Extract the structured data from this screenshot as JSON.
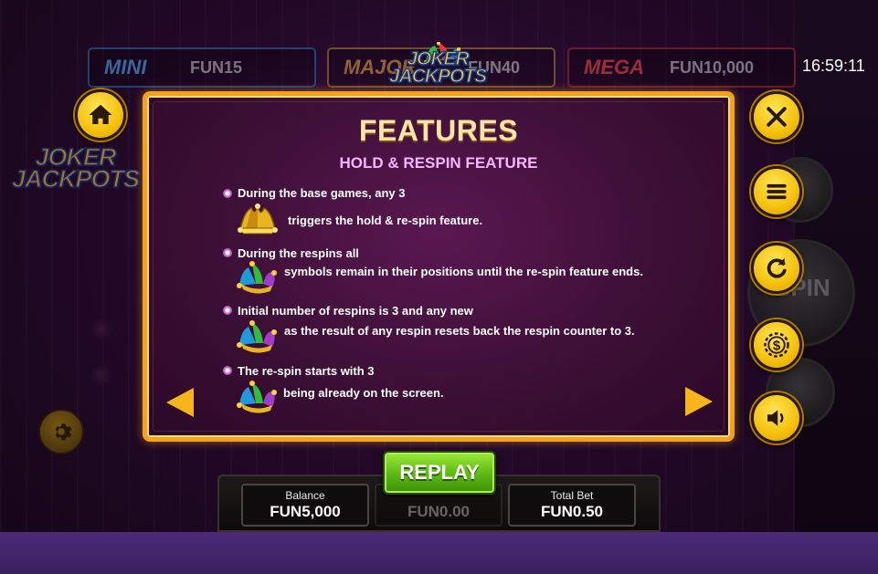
{
  "clock": "16:59:11",
  "jackpots": [
    {
      "name": "MINI",
      "value": "FUN15"
    },
    {
      "name": "MAJOR",
      "value": "FUN40"
    },
    {
      "name": "MEGA",
      "value": "FUN10,000"
    }
  ],
  "logo": {
    "line1": "JOKER",
    "line2": "JACKPOTS"
  },
  "panel": {
    "title": "FEATURES",
    "subtitle": "HOLD & RESPIN FEATURE",
    "features": [
      {
        "line1": "During the base games, any 3",
        "line2": "triggers the hold & re-spin feature.",
        "symbol": "golden-jester-hat"
      },
      {
        "line1": "During the respins all",
        "line2": "symbols remain in their positions until the re-spin feature ends.",
        "symbol": "jester-hat"
      },
      {
        "line1": "Initial number of respins is 3 and any new",
        "line2": "as the result of any respin resets back the respin counter to 3.",
        "symbol": "jester-hat"
      },
      {
        "line1": "The re-spin starts with 3",
        "line2": "being already on the screen.",
        "symbol": "jester-hat"
      }
    ]
  },
  "buttons": {
    "replay": "REPLAY",
    "spin_ghost": "SPIN"
  },
  "stats": {
    "balance_label": "Balance",
    "balance_value": "FUN5,000",
    "win_value": "FUN0.00",
    "total_bet_label": "Total Bet",
    "total_bet_value": "FUN0.50"
  },
  "colors": {
    "panel_border": "#f4a21a",
    "title": "#ffe4a6",
    "subtitle": "#f5b6ff",
    "round_button": "#f6c40f",
    "replay_button": "#5fbd14"
  },
  "icons": [
    "home-icon",
    "close-icon",
    "menu-icon",
    "refresh-icon",
    "coin-dollar-icon",
    "speaker-icon",
    "gear-icon",
    "arrow-left-icon",
    "arrow-right-icon"
  ]
}
